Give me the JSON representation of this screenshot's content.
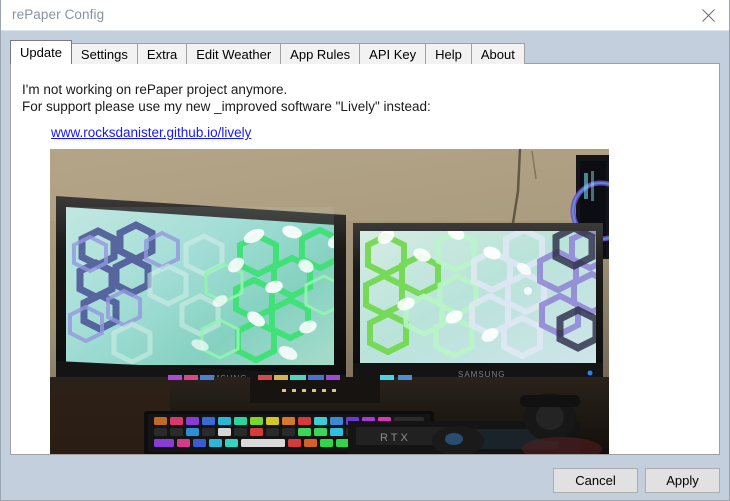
{
  "window": {
    "title": "rePaper Config",
    "close_icon": "close-icon",
    "bg_color": "#c3cfdd",
    "panel_bg": "#ffffff"
  },
  "tabs": [
    {
      "label": "Update",
      "active": true
    },
    {
      "label": "Settings",
      "active": false
    },
    {
      "label": "Extra",
      "active": false
    },
    {
      "label": "Edit Weather",
      "active": false
    },
    {
      "label": "App Rules",
      "active": false
    },
    {
      "label": "API Key",
      "active": false
    },
    {
      "label": "Help",
      "active": false
    },
    {
      "label": "About",
      "active": false
    }
  ],
  "update_tab": {
    "line1": "I'm not working on rePaper project anymore.",
    "line2": "For support please use my new _improved software \"Lively\" instead:",
    "link_text": "www.rocksdanister.github.io/lively",
    "link_color": "#1a1ae8",
    "image_alt": "Photo of two desktop monitors displaying a green and purple hexagon honeycomb live wallpaper, above an RGB backlit keyboard, mouse and RTX graphics card"
  },
  "footer": {
    "cancel_label": "Cancel",
    "apply_label": "Apply"
  }
}
